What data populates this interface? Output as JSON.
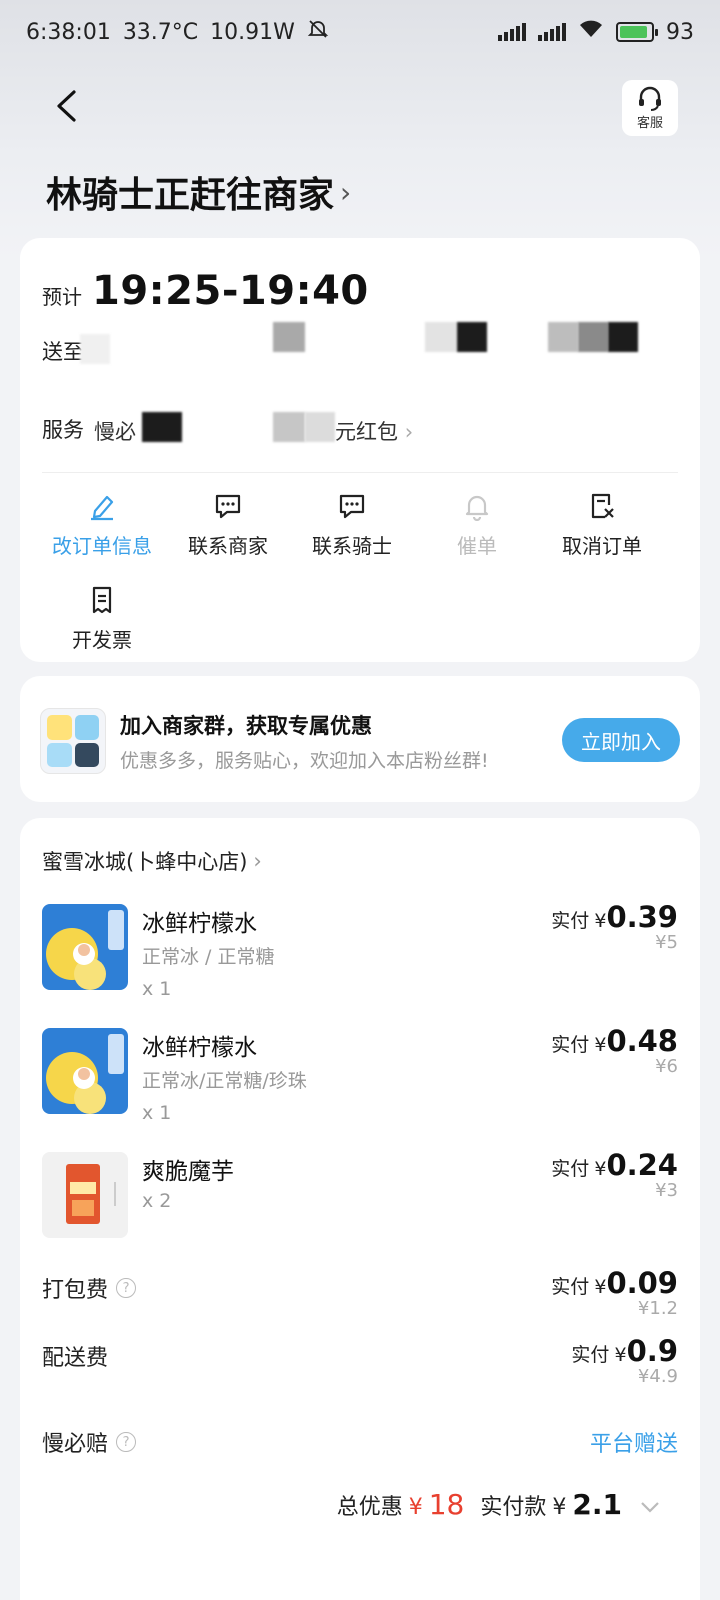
{
  "status_bar": {
    "time": "6:38:01",
    "temperature": "33.7°C",
    "power": "10.91W",
    "battery": "93"
  },
  "header": {
    "service_label": "客服",
    "title": "林骑士正赶往商家",
    "title_chevron": "›"
  },
  "delivery": {
    "eta_label": "预计",
    "eta_time": "19:25-19:40",
    "address_label": "送至",
    "service_label": "服务",
    "service_visible_1": "慢必",
    "service_visible_2": "元红包",
    "service_chevron": "›"
  },
  "actions": [
    {
      "label": "改订单信息"
    },
    {
      "label": "联系商家"
    },
    {
      "label": "联系骑士"
    },
    {
      "label": "催单"
    },
    {
      "label": "取消订单"
    },
    {
      "label": "开发票"
    }
  ],
  "group": {
    "title": "加入商家群，获取专属优惠",
    "subtitle": "优惠多多，服务贴心，欢迎加入本店粉丝群!",
    "button": "立即加入"
  },
  "order": {
    "shop_name": "蜜雪冰城(卜蜂中心店)",
    "shop_chevron": "›",
    "pay_label": "实付",
    "currency": "¥",
    "items": [
      {
        "name": "冰鲜柠檬水",
        "spec": "正常冰 / 正常糖",
        "qty": "x 1",
        "paid": "0.39",
        "original": "¥5"
      },
      {
        "name": "冰鲜柠檬水",
        "spec": "正常冰/正常糖/珍珠",
        "qty": "x 1",
        "paid": "0.48",
        "original": "¥6"
      },
      {
        "name": "爽脆魔芋",
        "spec": "",
        "qty": "x 2",
        "paid": "0.24",
        "original": "¥3"
      }
    ],
    "fees": [
      {
        "label": "打包费",
        "paid": "0.09",
        "original": "¥1.2"
      },
      {
        "label": "配送费",
        "paid": "0.9",
        "original": "¥4.9"
      }
    ],
    "guarantee": {
      "label": "慢必赔",
      "value": "平台赠送"
    },
    "help_mark": "?",
    "total": {
      "discount_label": "总优惠",
      "discount_value": "18",
      "paid_label": "实付款",
      "paid_value": "2.1"
    }
  },
  "colors": {
    "accent": "#46aaea",
    "discount": "#e8402f"
  }
}
